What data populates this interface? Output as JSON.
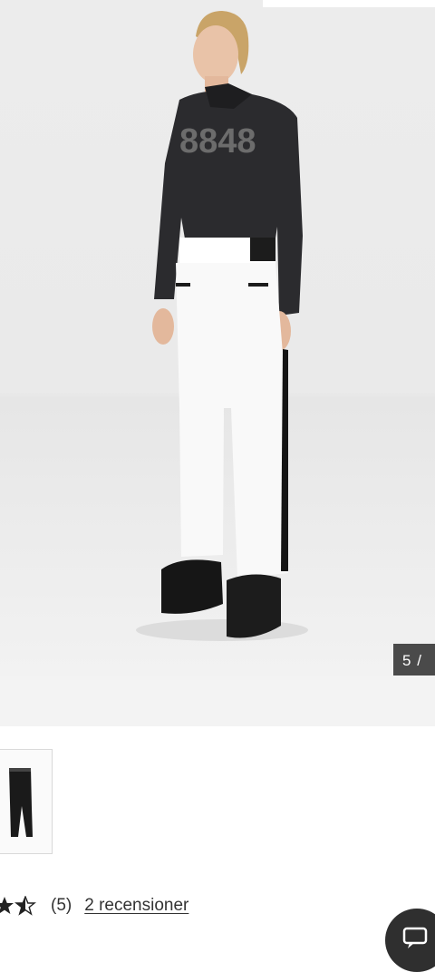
{
  "gallery": {
    "counter": {
      "current": "5",
      "separator": "/"
    },
    "brand_print": "8848",
    "thumbnail_icon": "pants-thumbnail"
  },
  "rating": {
    "stars_filled": 1.5,
    "stars_visible": 2,
    "count": "(5)",
    "reviews_link": "2 recensioner"
  },
  "chat": {
    "icon": "chat-icon"
  },
  "colors": {
    "counter_bg": "#4a4a4a",
    "hero_bg": "#ececec",
    "chat_bg": "#2f2f2f"
  }
}
